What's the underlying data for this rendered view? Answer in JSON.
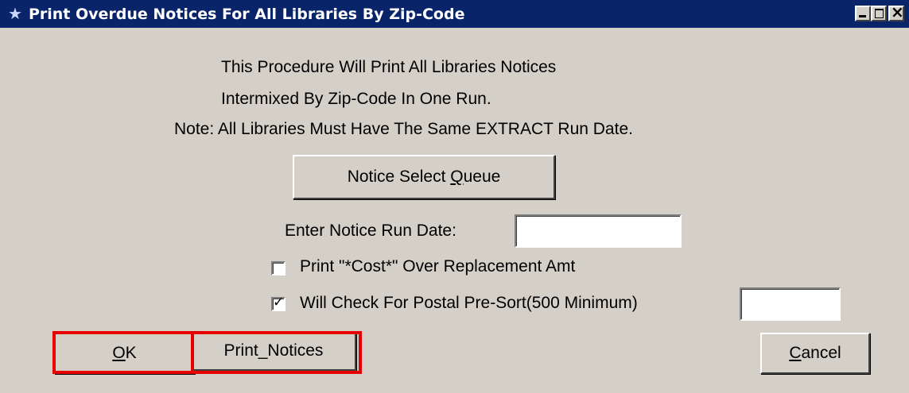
{
  "window": {
    "title": "Print Overdue Notices For All Libraries By Zip-Code",
    "icon": "star-person-icon"
  },
  "info": {
    "line1": "This Procedure Will Print All Libraries Notices",
    "line2": "Intermixed By Zip-Code In One Run.",
    "line3": "Note: All Libraries Must Have The Same EXTRACT Run Date."
  },
  "queue_button": {
    "label_pre": "Notice Select ",
    "label_u": "Q",
    "label_post": "ueue"
  },
  "run_date": {
    "label": "Enter Notice Run Date:",
    "value": ""
  },
  "cost_option": {
    "label": "Print \"*Cost*\" Over Replacement Amt",
    "checked": false
  },
  "presort_option": {
    "label": "Will Check For Postal Pre-Sort(500 Minimum)",
    "checked": true,
    "value": ""
  },
  "buttons": {
    "ok_u": "O",
    "ok_post": "K",
    "print_notices": "Print_Notices",
    "cancel_u": "C",
    "cancel_post": "ancel"
  },
  "colors": {
    "titlebar": "#0a246a",
    "face": "#d4d0c8",
    "highlight": "#e60000"
  }
}
